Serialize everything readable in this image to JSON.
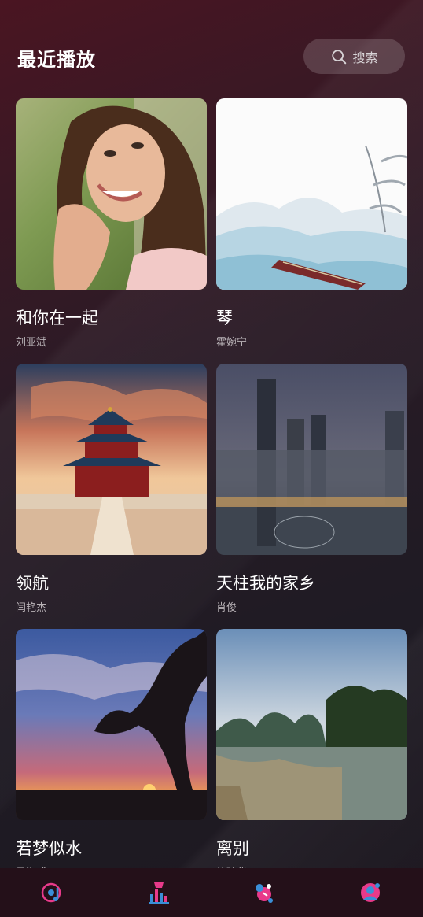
{
  "header": {
    "title": "最近播放",
    "search_label": "搜索"
  },
  "songs": [
    {
      "title": "和你在一起",
      "artist": "刘亚斌",
      "cover": "portrait-woman"
    },
    {
      "title": "琴",
      "artist": "霍婉宁",
      "cover": "chinese-painting-guqin"
    },
    {
      "title": "领航",
      "artist": "闫艳杰",
      "cover": "temple-of-heaven"
    },
    {
      "title": "天柱我的家乡",
      "artist": "肖俊",
      "cover": "city-skyline-night"
    },
    {
      "title": "若梦似水",
      "artist": "吴海威",
      "cover": "tree-sunset"
    },
    {
      "title": "离别",
      "artist": "徐琦华",
      "cover": "karst-river"
    }
  ],
  "tabbar": {
    "items": [
      {
        "icon": "music-disc-icon"
      },
      {
        "icon": "chart-trophy-icon"
      },
      {
        "icon": "discover-icon"
      },
      {
        "icon": "profile-icon"
      }
    ],
    "accent_pink": "#e83a8a",
    "accent_blue": "#3a8fd8"
  }
}
